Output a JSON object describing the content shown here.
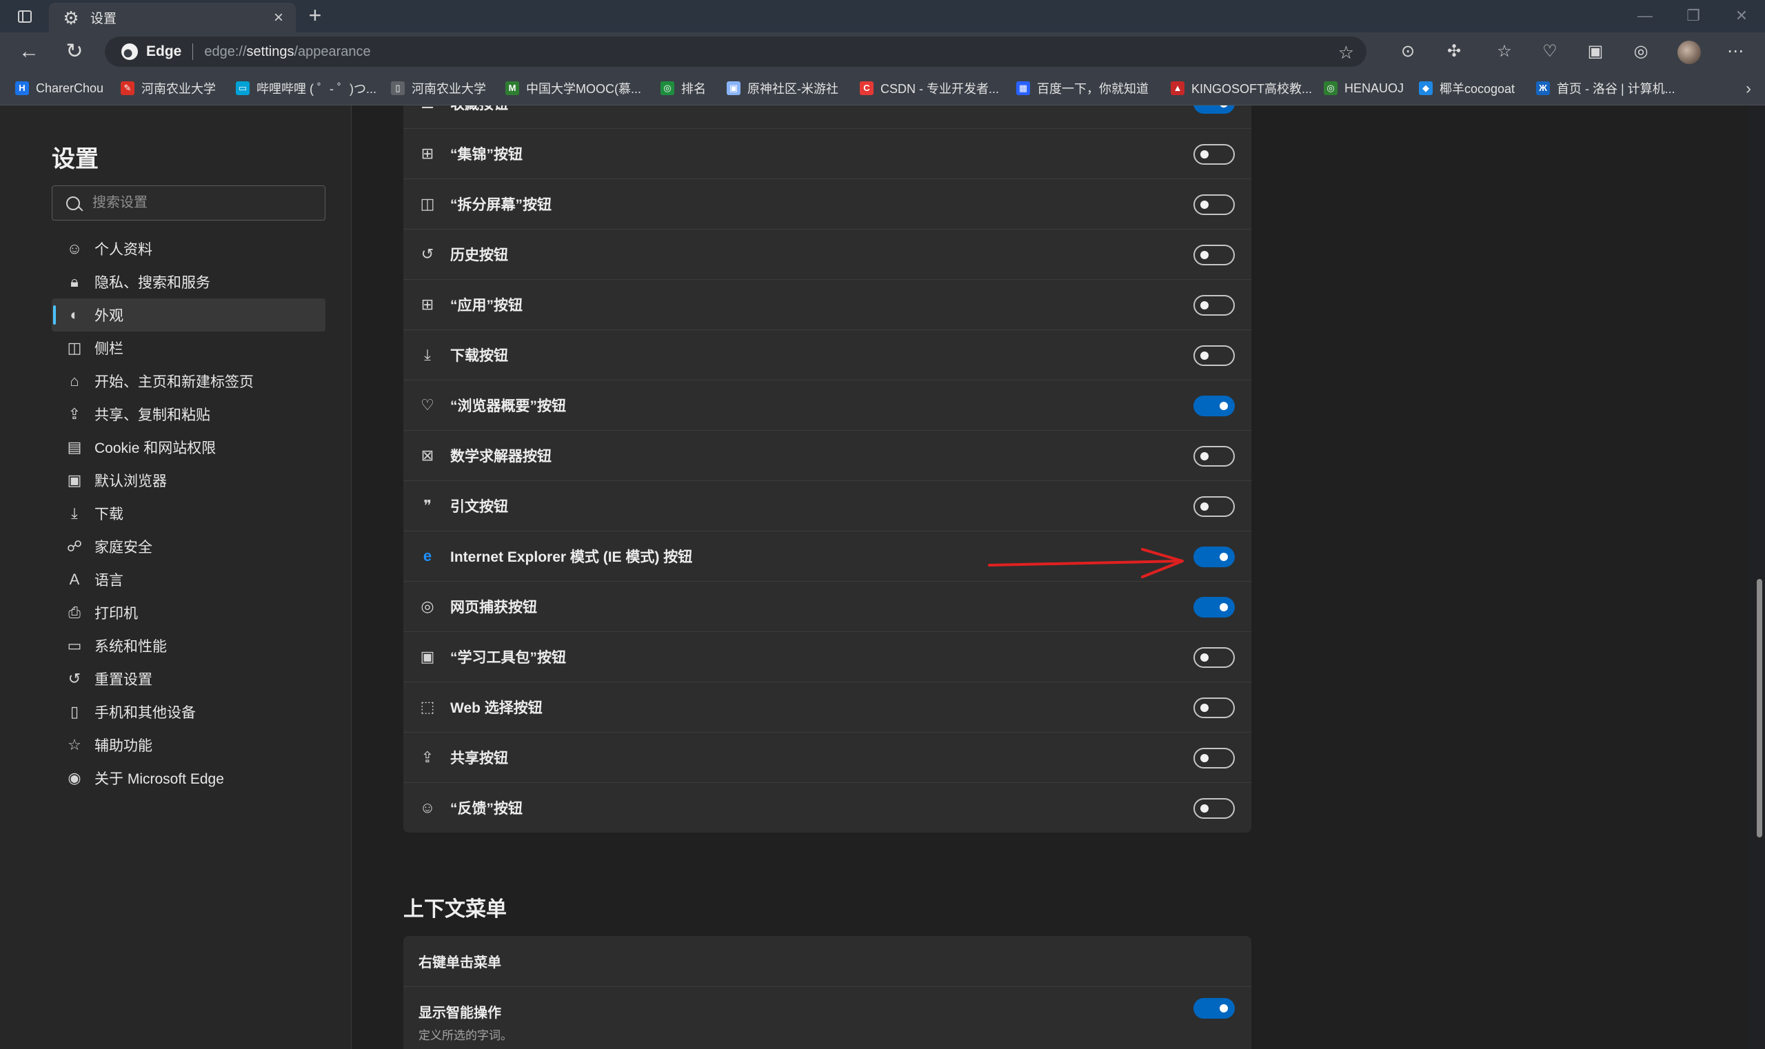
{
  "window": {
    "tab_title": "设置",
    "tab_icon": "gear-icon"
  },
  "toolbar": {
    "app_name": "Edge",
    "url_prefix": "edge://",
    "url_bold": "settings",
    "url_rest": "/appearance"
  },
  "bookmarks": [
    {
      "label": "CharerChou",
      "icon_color": "#1a73e8",
      "glyph": "H"
    },
    {
      "label": "河南农业大学",
      "icon_color": "#d93025",
      "glyph": "✎"
    },
    {
      "label": "哔哩哔哩 ( ゜- ゜)つ...",
      "icon_color": "#00a1d6",
      "glyph": "▭"
    },
    {
      "label": "河南农业大学",
      "icon_color": "#5f6368",
      "glyph": "▯"
    },
    {
      "label": "中国大学MOOC(慕...",
      "icon_color": "#2e7d32",
      "glyph": "M"
    },
    {
      "label": "排名",
      "icon_color": "#1e8e3e",
      "glyph": "◎"
    },
    {
      "label": "原神社区-米游社",
      "icon_color": "#8ab4f8",
      "glyph": "▣"
    },
    {
      "label": "CSDN - 专业开发者...",
      "icon_color": "#e53935",
      "glyph": "C"
    },
    {
      "label": "百度一下，你就知道",
      "icon_color": "#2962ff",
      "glyph": "▦"
    },
    {
      "label": "KINGOSOFT高校教...",
      "icon_color": "#c62828",
      "glyph": "▲"
    },
    {
      "label": "HENAUOJ",
      "icon_color": "#2e7d32",
      "glyph": "◎"
    },
    {
      "label": "椰羊cocogoat",
      "icon_color": "#1e88e5",
      "glyph": "◆"
    },
    {
      "label": "首页 - 洛谷 | 计算机...",
      "icon_color": "#1565c0",
      "glyph": "Ж"
    }
  ],
  "sidebar": {
    "title": "设置",
    "search_placeholder": "搜索设置",
    "items": [
      {
        "label": "个人资料",
        "icon": "profile-icon",
        "glyph": "☺"
      },
      {
        "label": "隐私、搜索和服务",
        "icon": "lock-icon",
        "glyph": "🔒︎"
      },
      {
        "label": "外观",
        "icon": "palette-icon",
        "glyph": "◐",
        "active": true
      },
      {
        "label": "侧栏",
        "icon": "sidebar-icon",
        "glyph": "◫"
      },
      {
        "label": "开始、主页和新建标签页",
        "icon": "home-icon",
        "glyph": "⌂"
      },
      {
        "label": "共享、复制和粘贴",
        "icon": "share-icon",
        "glyph": "⇪"
      },
      {
        "label": "Cookie 和网站权限",
        "icon": "cookie-icon",
        "glyph": "▤"
      },
      {
        "label": "默认浏览器",
        "icon": "browser-icon",
        "glyph": "▣"
      },
      {
        "label": "下载",
        "icon": "download-icon",
        "glyph": "⤓"
      },
      {
        "label": "家庭安全",
        "icon": "family-icon",
        "glyph": "☍"
      },
      {
        "label": "语言",
        "icon": "language-icon",
        "glyph": "A"
      },
      {
        "label": "打印机",
        "icon": "printer-icon",
        "glyph": "⎙"
      },
      {
        "label": "系统和性能",
        "icon": "system-icon",
        "glyph": "▭"
      },
      {
        "label": "重置设置",
        "icon": "reset-icon",
        "glyph": "↺"
      },
      {
        "label": "手机和其他设备",
        "icon": "phone-icon",
        "glyph": "▯"
      },
      {
        "label": "辅助功能",
        "icon": "accessibility-icon",
        "glyph": "☆"
      },
      {
        "label": "关于 Microsoft Edge",
        "icon": "edge-icon",
        "glyph": "◉"
      }
    ]
  },
  "buttons_list": [
    {
      "label": "收藏按钮",
      "icon": "favorites-icon",
      "glyph": "☰",
      "on": true
    },
    {
      "label": "“集锦”按钮",
      "icon": "collections-icon",
      "glyph": "⊞",
      "on": false
    },
    {
      "label": "“拆分屏幕”按钮",
      "icon": "split-screen-icon",
      "glyph": "◫",
      "on": false
    },
    {
      "label": "历史按钮",
      "icon": "history-icon",
      "glyph": "↺",
      "on": false
    },
    {
      "label": "“应用”按钮",
      "icon": "apps-icon",
      "glyph": "⊞",
      "on": false
    },
    {
      "label": "下载按钮",
      "icon": "download-icon",
      "glyph": "⤓",
      "on": false
    },
    {
      "label": "“浏览器概要”按钮",
      "icon": "essentials-icon",
      "glyph": "♡",
      "on": true
    },
    {
      "label": "数学求解器按钮",
      "icon": "math-solver-icon",
      "glyph": "⊠",
      "on": false
    },
    {
      "label": "引文按钮",
      "icon": "citation-icon",
      "glyph": "❞",
      "on": false
    },
    {
      "label": "Internet Explorer 模式 (IE 模式) 按钮",
      "icon": "ie-mode-icon",
      "glyph": "e",
      "on": true
    },
    {
      "label": "网页捕获按钮",
      "icon": "web-capture-icon",
      "glyph": "◎",
      "on": true
    },
    {
      "label": "“学习工具包”按钮",
      "icon": "learning-toolkit-icon",
      "glyph": "▣",
      "on": false
    },
    {
      "label": "Web 选择按钮",
      "icon": "web-select-icon",
      "glyph": "⬚",
      "on": false
    },
    {
      "label": "共享按钮",
      "icon": "share-icon",
      "glyph": "⇪",
      "on": false
    },
    {
      "label": "“反馈”按钮",
      "icon": "feedback-icon",
      "glyph": "☺",
      "on": false
    }
  ],
  "context_menu": {
    "section_title": "上下文菜单",
    "subheading": "右键单击菜单",
    "smart_actions_label": "显示智能操作",
    "smart_actions_note": "定义所选的字词。",
    "smart_actions_on": true
  },
  "colors": {
    "accent": "#0067c0",
    "active_indicator": "#4cc2ff",
    "annotation_arrow": "#e02020"
  }
}
